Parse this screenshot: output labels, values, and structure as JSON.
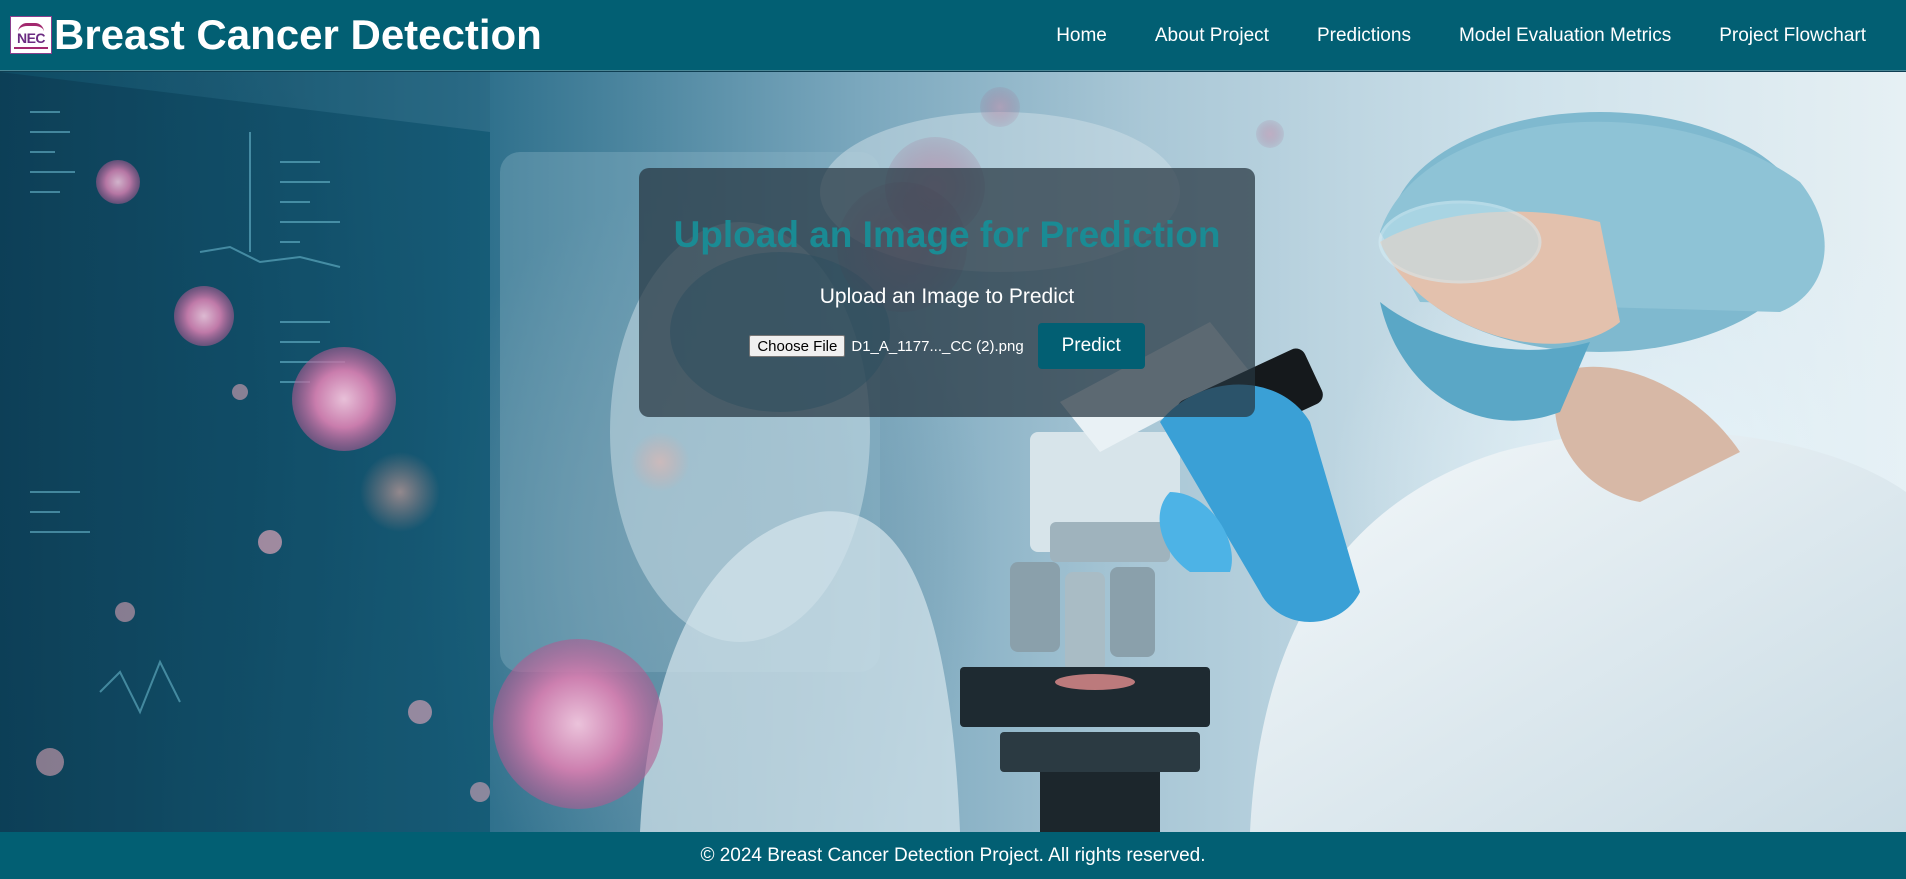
{
  "header": {
    "logo_text": "NEC",
    "title": "Breast Cancer Detection",
    "nav": [
      {
        "label": "Home"
      },
      {
        "label": "About Project"
      },
      {
        "label": "Predictions"
      },
      {
        "label": "Model Evaluation Metrics"
      },
      {
        "label": "Project Flowchart"
      }
    ]
  },
  "upload_card": {
    "title": "Upload an Image for Prediction",
    "subtitle": "Upload an Image to Predict",
    "choose_file_label": "Choose File",
    "file_name": "D1_A_1177..._CC (2).png",
    "predict_label": "Predict"
  },
  "footer": {
    "copyright": "© 2024 Breast Cancer Detection Project. All rights reserved."
  },
  "colors": {
    "header_bg": "#025f73",
    "footer_bg": "#025f73",
    "card_title": "#1a8b94",
    "predict_button": "#025f73",
    "card_bg": "rgba(38,52,64,0.72)"
  },
  "icons": {
    "logo": "nec-logo-icon"
  }
}
